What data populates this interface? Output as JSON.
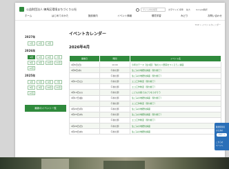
{
  "header": {
    "site_name": "公益財団法人 練馬区環境まちづくり公社",
    "search_placeholder": "サイト内を検索",
    "utility_links": [
      "文字サイズ",
      "標準",
      "拡大",
      "Google翻訳"
    ],
    "nav": [
      "ホーム",
      "はじめてのかた",
      "施設案内",
      "イベント情報",
      "環境学習",
      "みどり",
      "お問い合わせ"
    ]
  },
  "breadcrumb": "TOP > イベントカレンダー",
  "page_title": "イベントカレンダー",
  "month_heading": "2026年4月",
  "sidebar": {
    "years": [
      {
        "label": "2027年",
        "months": [
          "1月",
          "2月",
          "3月"
        ],
        "active": ""
      },
      {
        "label": "2026年",
        "months": [
          "4月",
          "5月",
          "6月",
          "7月",
          "8月",
          "9月",
          "10月",
          "11月",
          "12月"
        ],
        "active": "4月"
      },
      {
        "label": "2025年",
        "months": [
          "4月",
          "5月",
          "6月",
          "7月",
          "8月",
          "9月",
          "10月",
          "11月",
          "12月"
        ],
        "active": ""
      }
    ],
    "button_label": "最新のイベント一覧"
  },
  "table": {
    "headers": [
      "開催日",
      "時間",
      "イベント名"
    ],
    "rows": [
      {
        "date": "4月5日(日)",
        "time": "10:00",
        "name": "今年のテーマ【全4回】「春のミニ野菜をつくろう」講座"
      },
      {
        "date": "4月8日(水)",
        "time": "午前の部",
        "name": "生ごみの堆肥化講座（受付終了）"
      },
      {
        "date": "",
        "time": "午後の部",
        "name": "生ごみの堆肥化講座（受付終了）"
      },
      {
        "date": "4月11日(土)",
        "time": "午前の部",
        "name": "エコ工作教室（受付終了）"
      },
      {
        "date": "",
        "time": "午後の部",
        "name": "エコ工作教室（受付終了）"
      },
      {
        "date": "4月14日(火)",
        "time": "午前の部",
        "name": "こどもの森でみどりをさがそう"
      },
      {
        "date": "4月17日(金)",
        "time": "午前の部",
        "name": "生ごみの堆肥化講座（受付終了）"
      },
      {
        "date": "",
        "time": "午後の部",
        "name": "エコ工作教室（受付終了）"
      },
      {
        "date": "4月20日(月)",
        "time": "午前の部",
        "name": "生ごみの堆肥化講座"
      },
      {
        "date": "4月23日(木)",
        "time": "午前の部",
        "name": "生ごみの堆肥化講座（受付終了）"
      },
      {
        "date": "",
        "time": "午後の部",
        "name": "エコ工作教室（受付終了）"
      },
      {
        "date": "4月26日(日)",
        "time": "午前の部",
        "name": "生ごみの堆肥化講座"
      },
      {
        "date": "4月29日(水)",
        "time": "午前の部",
        "name": "生ごみの堆肥化講座"
      }
    ]
  },
  "floating_widget": {
    "line1": "聴覚障害者",
    "line2": "のための",
    "button": "サポート",
    "line3": "こちらの",
    "line4": "ページへ"
  },
  "colors": {
    "brand_green": "#2f8a3c",
    "widget_blue": "#2a6fb8"
  }
}
